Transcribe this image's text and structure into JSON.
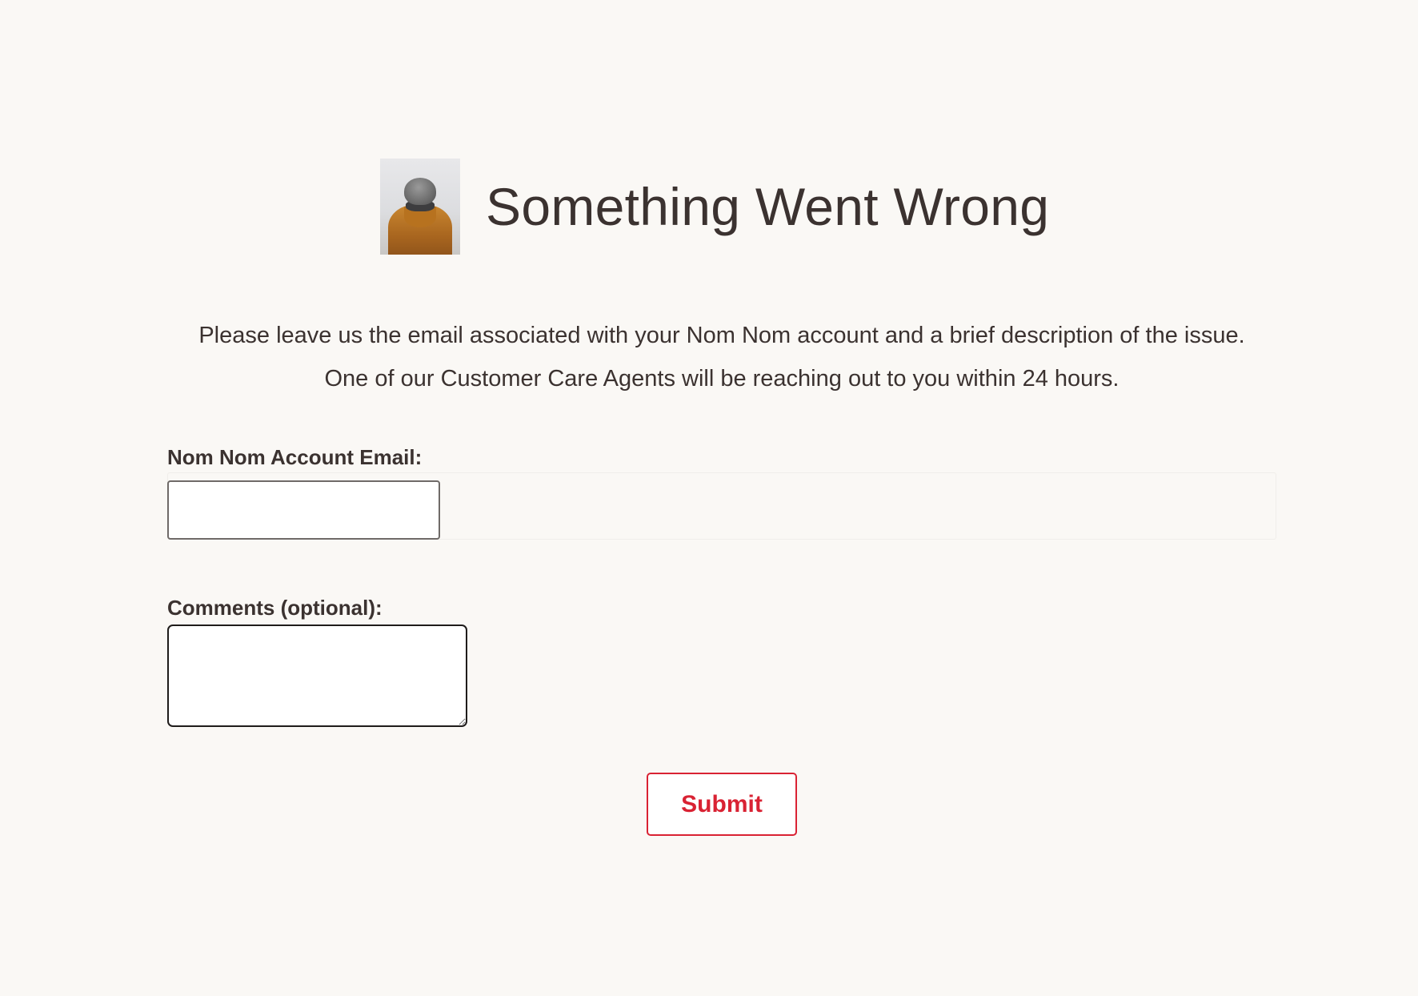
{
  "header": {
    "title": "Something Went Wrong"
  },
  "intro": {
    "line1": "Please leave us the email associated with your Nom Nom account and a brief description of the issue.",
    "line2": "One of our Customer Care Agents will be reaching out to you within 24 hours."
  },
  "form": {
    "email_label": "Nom Nom Account Email:",
    "email_value": "",
    "email_placeholder": "",
    "comments_label": "Comments (optional):",
    "comments_value": "",
    "submit_label": "Submit"
  },
  "colors": {
    "background": "#faf8f5",
    "text": "#3b3230",
    "accent": "#d92233"
  },
  "icons": {
    "avatar": "person-in-beanie-photo"
  }
}
